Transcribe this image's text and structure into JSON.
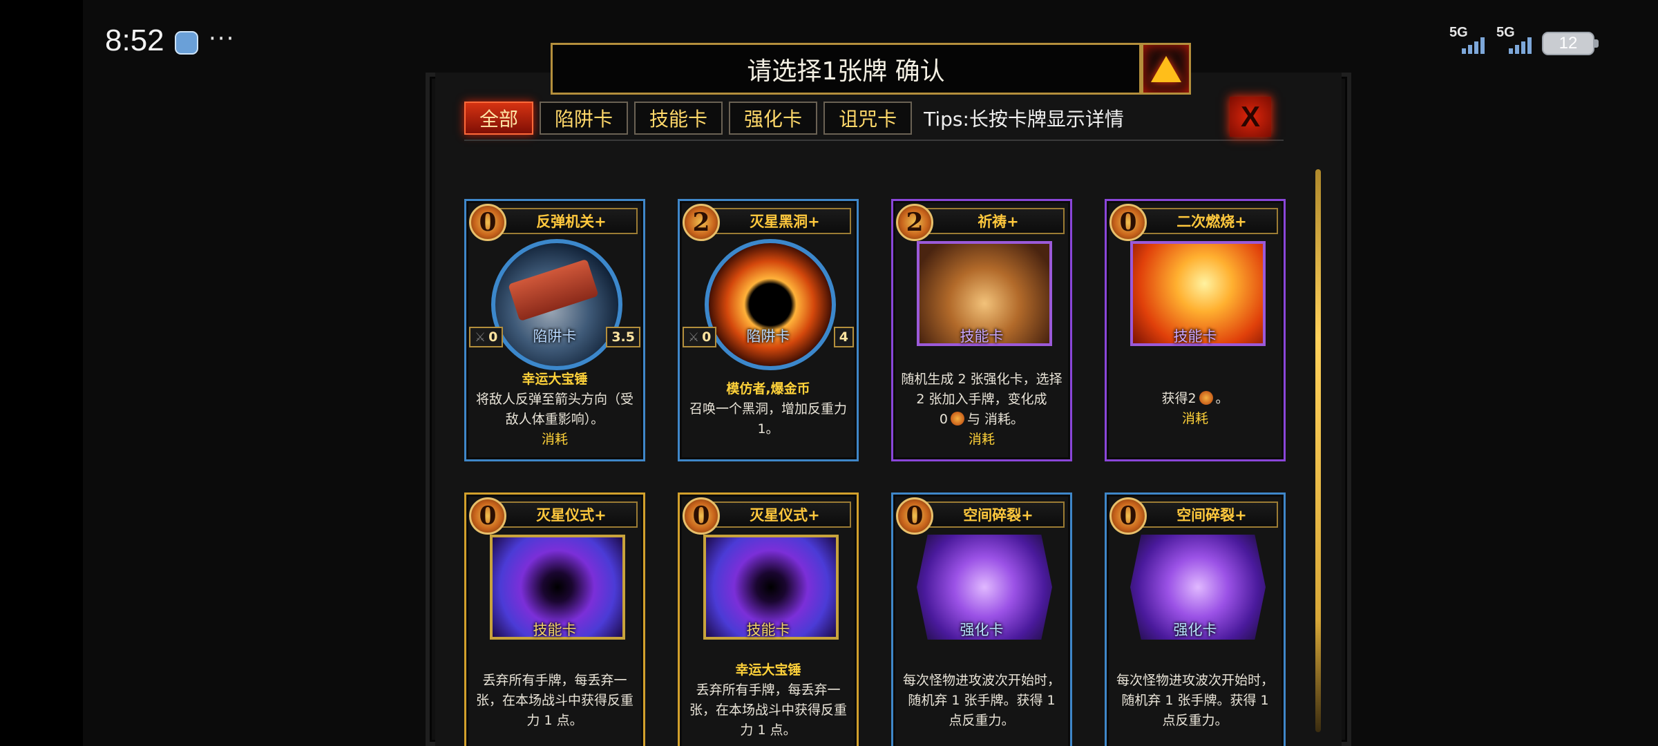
{
  "status_bar": {
    "time": "8:52",
    "more": "···",
    "sim1": "5G",
    "sim2": "5G",
    "battery": "12"
  },
  "dialog": {
    "title": "请选择1张牌 确认",
    "confirm_icon": "triangle-up-icon",
    "close_label": "X",
    "tips": "Tips:长按卡牌显示详情",
    "tabs": [
      {
        "label": "全部",
        "active": true
      },
      {
        "label": "陷阱卡",
        "active": false
      },
      {
        "label": "技能卡",
        "active": false
      },
      {
        "label": "强化卡",
        "active": false
      },
      {
        "label": "诅咒卡",
        "active": false
      }
    ]
  },
  "cards": [
    {
      "name": "反弹机关+",
      "cost": "0",
      "type": "陷阱卡",
      "stat_left": "0",
      "stat_right": "3.5",
      "keyword": "幸运大宝锤",
      "desc": "将敌人反弹至箭头方向（受敌人体重影响）。",
      "tail": "消耗"
    },
    {
      "name": "灭星黑洞+",
      "cost": "2",
      "type": "陷阱卡",
      "stat_left": "0",
      "stat_right": "4",
      "keyword": "模仿者,爆金币",
      "desc": "召唤一个黑洞，增加反重力1。",
      "tail": ""
    },
    {
      "name": "祈祷+",
      "cost": "2",
      "type": "技能卡",
      "keyword": "",
      "desc_a": "随机生成 2 张强化卡，选择 2 张加入手牌，变化成",
      "desc_b": "0",
      "desc_c": "与 消耗。",
      "tail": "消耗"
    },
    {
      "name": "二次燃烧+",
      "cost": "0",
      "type": "技能卡",
      "keyword": "",
      "desc_a": "获得2",
      "desc_c": "。",
      "tail": "消耗"
    },
    {
      "name": "灭星仪式+",
      "cost": "0",
      "type": "技能卡",
      "keyword": "",
      "desc": "丢弃所有手牌，每丢弃一张，在本场战斗中获得反重力 1 点。",
      "tail": ""
    },
    {
      "name": "灭星仪式+",
      "cost": "0",
      "type": "技能卡",
      "keyword": "幸运大宝锤",
      "desc": "丢弃所有手牌，每丢弃一张，在本场战斗中获得反重力 1 点。",
      "tail": ""
    },
    {
      "name": "空间碎裂+",
      "cost": "0",
      "type": "强化卡",
      "keyword": "",
      "desc": "每次怪物进攻波次开始时，随机弃 1 张手牌。获得 1 点反重力。",
      "tail": ""
    },
    {
      "name": "空间碎裂+",
      "cost": "0",
      "type": "强化卡",
      "keyword": "",
      "desc": "每次怪物进攻波次开始时，随机弃 1 张手牌。获得 1 点反重力。",
      "tail": ""
    }
  ],
  "colors": {
    "accent_gold": "#ffc83d",
    "tab_active": "#d63312",
    "trap_border": "#3f87c9",
    "skill_border": "#8a46d9",
    "ritual_border": "#d2a02c"
  }
}
